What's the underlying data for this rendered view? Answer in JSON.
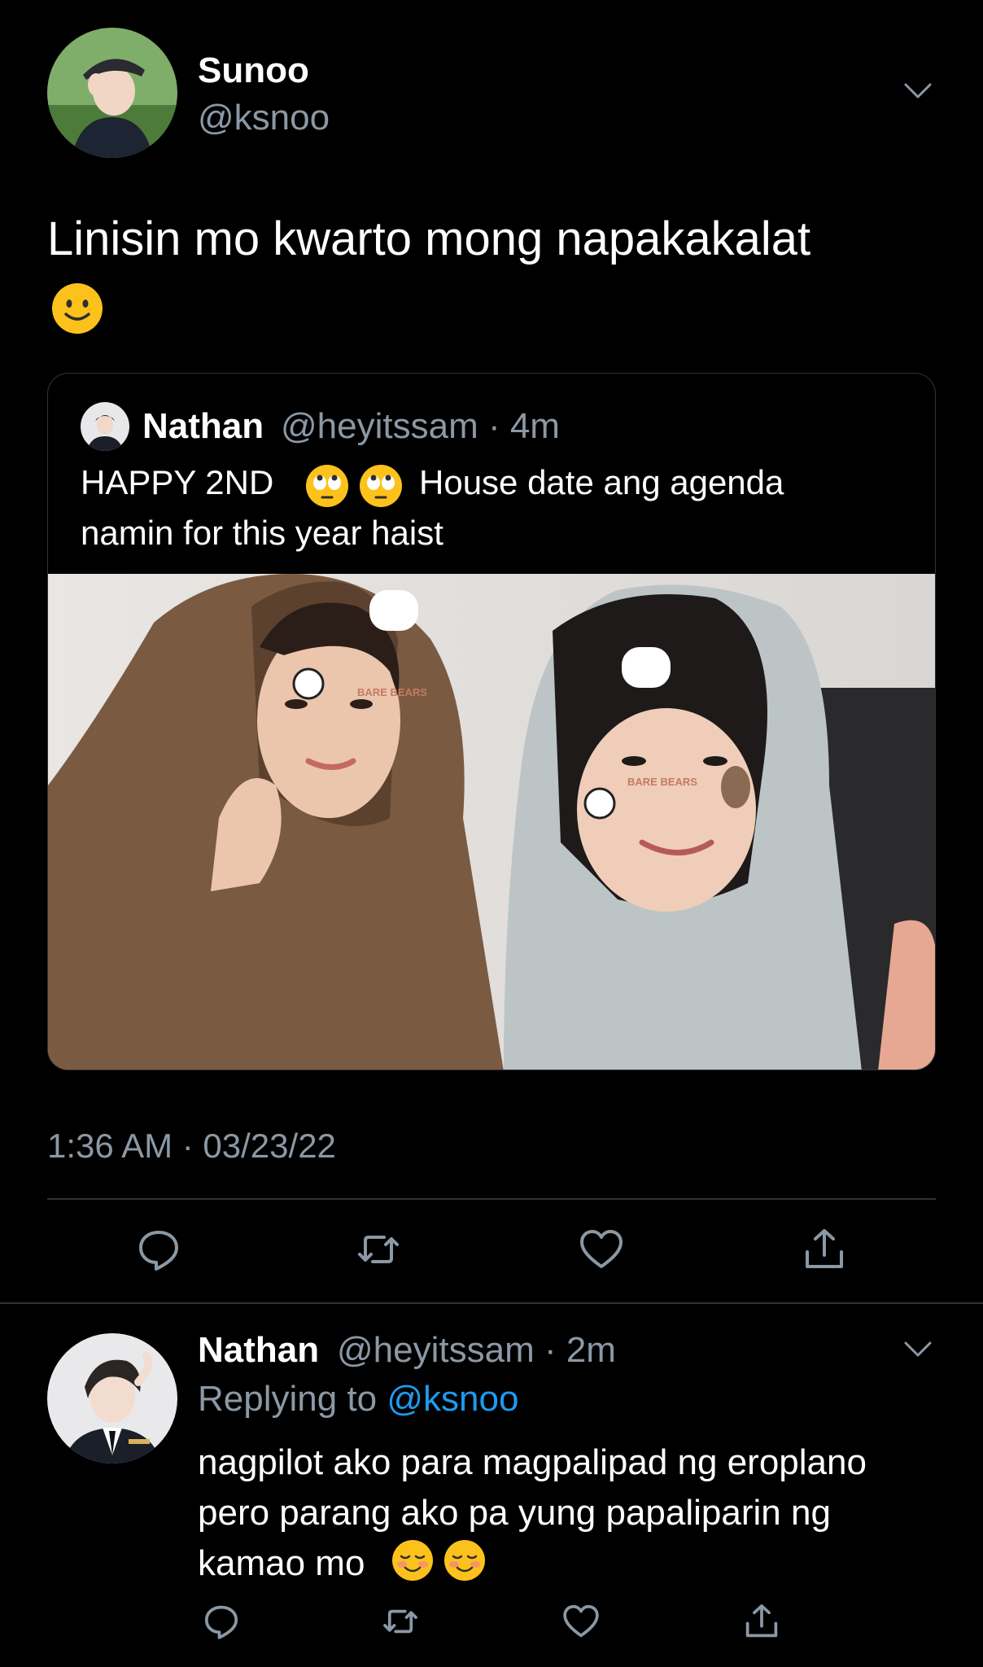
{
  "tweet": {
    "author_name": "Sunoo",
    "author_handle": "@ksnoo",
    "text": "Linisin mo kwarto mong napakakalat",
    "emoji": "slightly-smiling-face",
    "timestamp": "1:36 AM · 03/23/22"
  },
  "quote": {
    "author_name": "Nathan",
    "author_handle_time": "@heyitssam · 4m",
    "text_before_emoji": "HAPPY 2ND",
    "emoji": "face-with-rolling-eyes",
    "text_after_emoji": "House date ang agenda",
    "text_line2": "namin for this year haist",
    "photo_sticker_text": "BARE BEARS"
  },
  "reply": {
    "author_name": "Nathan",
    "author_handle_time": "@heyitssam · 2m",
    "replying_prefix": "Replying to",
    "replying_handle": "@ksnoo",
    "text": "nagpilot ako para magpalipad ng eroplano pero parang ako pa yung papaliparin ng kamao mo",
    "emoji": "smiling-face"
  },
  "actions": [
    "reply-icon",
    "retweet-icon",
    "like-icon",
    "share-icon"
  ],
  "colors": {
    "background": "#000000",
    "secondary_text": "#8b98a5",
    "link": "#1d9bf0",
    "border": "#2f3336"
  }
}
